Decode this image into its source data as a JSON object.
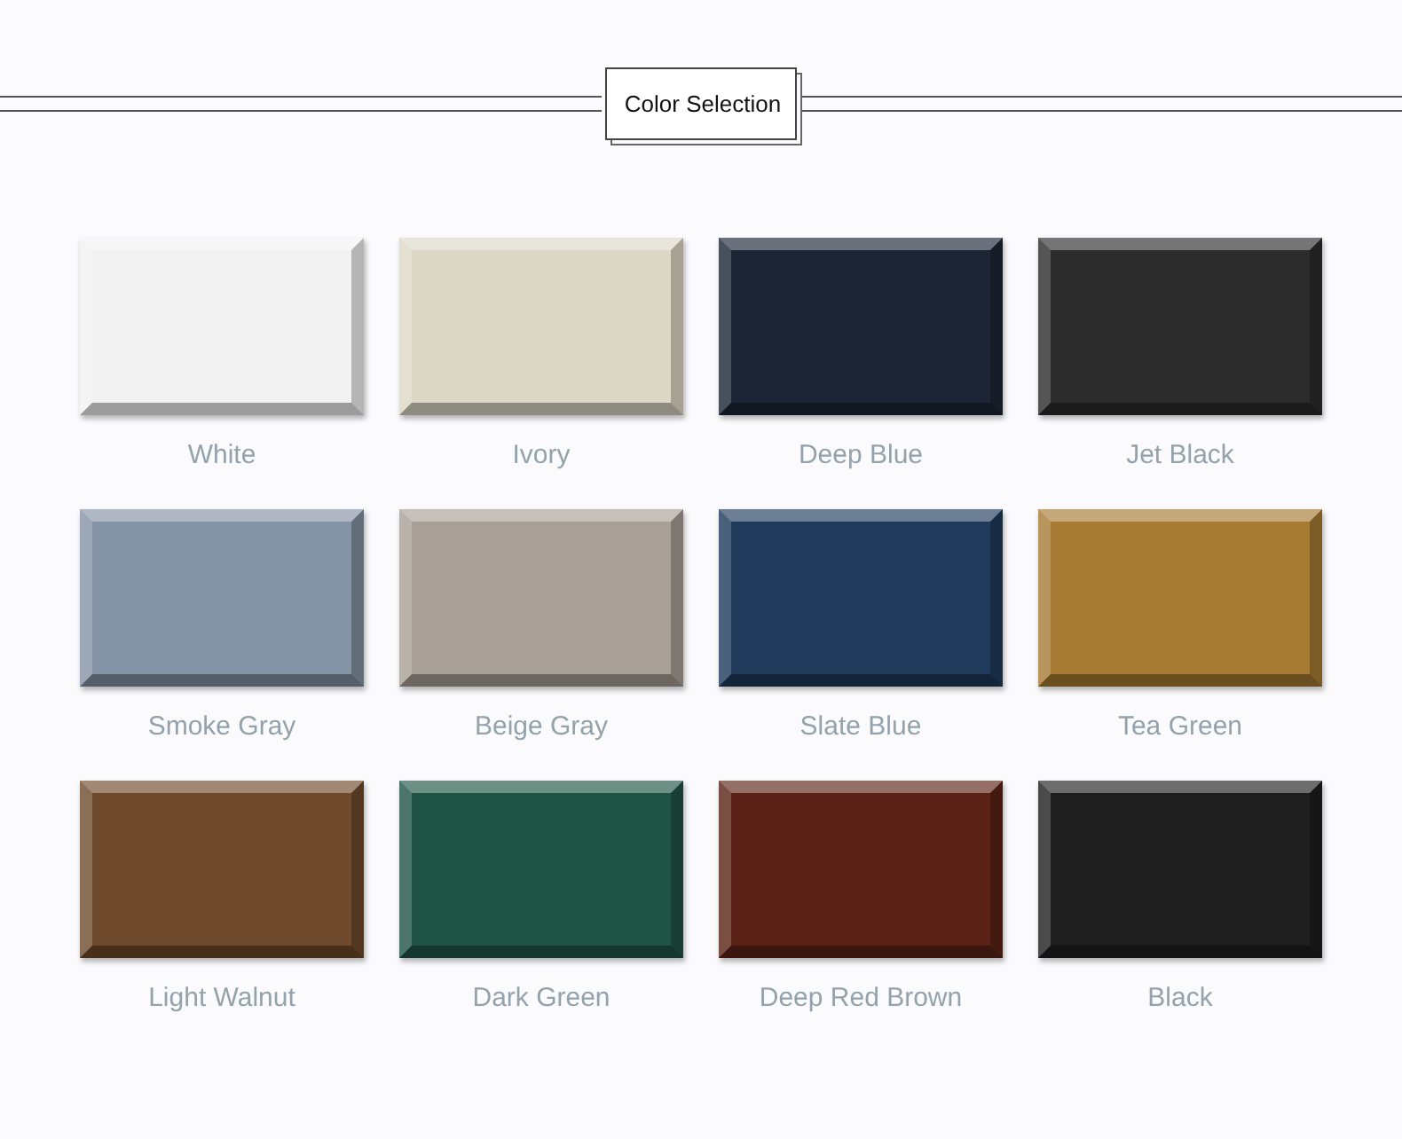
{
  "header": {
    "title": "Color Selection"
  },
  "swatches": [
    {
      "name": "White",
      "color": "#f2f2f2"
    },
    {
      "name": "Ivory",
      "color": "#dcd8c6"
    },
    {
      "name": "Deep Blue",
      "color": "#1c2535"
    },
    {
      "name": "Jet Black",
      "color": "#2b2b2b"
    },
    {
      "name": "Smoke Gray",
      "color": "#8493a5"
    },
    {
      "name": "Beige Gray",
      "color": "#a89f96"
    },
    {
      "name": "Slate Blue",
      "color": "#1f3a5a"
    },
    {
      "name": "Tea Green",
      "color": "#a77b34"
    },
    {
      "name": "Light Walnut",
      "color": "#6f4a2c"
    },
    {
      "name": "Dark Green",
      "color": "#1f5444"
    },
    {
      "name": "Deep Red Brown",
      "color": "#5a2216"
    },
    {
      "name": "Black",
      "color": "#1e1e1e"
    }
  ]
}
